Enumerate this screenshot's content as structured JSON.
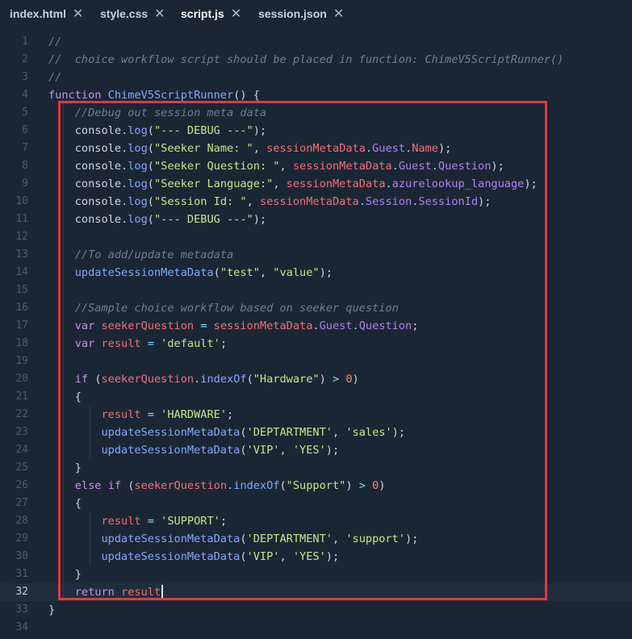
{
  "tabs": [
    {
      "label": "index.html",
      "active": false
    },
    {
      "label": "style.css",
      "active": false
    },
    {
      "label": "script.js",
      "active": true
    },
    {
      "label": "session.json",
      "active": false
    }
  ],
  "close_glyph": "✕",
  "current_line": 32,
  "code_lines": [
    {
      "n": "1",
      "tokens": [
        [
          "cm",
          "//"
        ]
      ]
    },
    {
      "n": "2",
      "tokens": [
        [
          "cm",
          "//  choice workflow script should be placed in function: ChimeV5ScriptRunner()"
        ]
      ]
    },
    {
      "n": "3",
      "tokens": [
        [
          "cm",
          "//"
        ]
      ]
    },
    {
      "n": "4",
      "tokens": [
        [
          "kw",
          "function "
        ],
        [
          "fn",
          "ChimeV5ScriptRunner"
        ],
        [
          "pn",
          "() {"
        ]
      ]
    },
    {
      "n": "5",
      "tokens": [
        [
          "pl",
          "    "
        ],
        [
          "cm",
          "//Debug out session meta data"
        ]
      ]
    },
    {
      "n": "6",
      "tokens": [
        [
          "pl",
          "    "
        ],
        [
          "pl",
          "console"
        ],
        [
          "op",
          "."
        ],
        [
          "fn",
          "log"
        ],
        [
          "pn",
          "("
        ],
        [
          "str",
          "\"--- DEBUG ---\""
        ],
        [
          "pn",
          ");"
        ]
      ]
    },
    {
      "n": "7",
      "tokens": [
        [
          "pl",
          "    "
        ],
        [
          "pl",
          "console"
        ],
        [
          "op",
          "."
        ],
        [
          "fn",
          "log"
        ],
        [
          "pn",
          "("
        ],
        [
          "str",
          "\"Seeker Name: \""
        ],
        [
          "pn",
          ", "
        ],
        [
          "var",
          "sessionMetaData"
        ],
        [
          "op",
          "."
        ],
        [
          "prop",
          "Guest"
        ],
        [
          "op",
          "."
        ],
        [
          "var",
          "Name"
        ],
        [
          "pn",
          ");"
        ]
      ]
    },
    {
      "n": "8",
      "tokens": [
        [
          "pl",
          "    "
        ],
        [
          "pl",
          "console"
        ],
        [
          "op",
          "."
        ],
        [
          "fn",
          "log"
        ],
        [
          "pn",
          "("
        ],
        [
          "str",
          "\"Seeker Question: \""
        ],
        [
          "pn",
          ", "
        ],
        [
          "var",
          "sessionMetaData"
        ],
        [
          "op",
          "."
        ],
        [
          "prop",
          "Guest"
        ],
        [
          "op",
          "."
        ],
        [
          "prop",
          "Question"
        ],
        [
          "pn",
          ");"
        ]
      ]
    },
    {
      "n": "9",
      "tokens": [
        [
          "pl",
          "    "
        ],
        [
          "pl",
          "console"
        ],
        [
          "op",
          "."
        ],
        [
          "fn",
          "log"
        ],
        [
          "pn",
          "("
        ],
        [
          "str",
          "\"Seeker Language:\""
        ],
        [
          "pn",
          ", "
        ],
        [
          "var",
          "sessionMetaData"
        ],
        [
          "op",
          "."
        ],
        [
          "prop",
          "azurelookup_language"
        ],
        [
          "pn",
          ");"
        ]
      ]
    },
    {
      "n": "10",
      "tokens": [
        [
          "pl",
          "    "
        ],
        [
          "pl",
          "console"
        ],
        [
          "op",
          "."
        ],
        [
          "fn",
          "log"
        ],
        [
          "pn",
          "("
        ],
        [
          "str",
          "\"Session Id: \""
        ],
        [
          "pn",
          ", "
        ],
        [
          "var",
          "sessionMetaData"
        ],
        [
          "op",
          "."
        ],
        [
          "prop",
          "Session"
        ],
        [
          "op",
          "."
        ],
        [
          "prop",
          "SessionId"
        ],
        [
          "pn",
          ");"
        ]
      ]
    },
    {
      "n": "11",
      "tokens": [
        [
          "pl",
          "    "
        ],
        [
          "pl",
          "console"
        ],
        [
          "op",
          "."
        ],
        [
          "fn",
          "log"
        ],
        [
          "pn",
          "("
        ],
        [
          "str",
          "\"--- DEBUG ---\""
        ],
        [
          "pn",
          ");"
        ]
      ]
    },
    {
      "n": "12",
      "tokens": []
    },
    {
      "n": "13",
      "tokens": [
        [
          "pl",
          "    "
        ],
        [
          "cm",
          "//To add/update metadata"
        ]
      ]
    },
    {
      "n": "14",
      "tokens": [
        [
          "pl",
          "    "
        ],
        [
          "fn",
          "updateSessionMetaData"
        ],
        [
          "pn",
          "("
        ],
        [
          "str",
          "\"test\""
        ],
        [
          "pn",
          ", "
        ],
        [
          "str",
          "\"value\""
        ],
        [
          "pn",
          ");"
        ]
      ]
    },
    {
      "n": "15",
      "tokens": []
    },
    {
      "n": "16",
      "tokens": [
        [
          "pl",
          "    "
        ],
        [
          "cm",
          "//Sample choice workflow based on seeker question"
        ]
      ]
    },
    {
      "n": "17",
      "tokens": [
        [
          "pl",
          "    "
        ],
        [
          "kw",
          "var "
        ],
        [
          "var",
          "seekerQuestion"
        ],
        [
          "op",
          " = "
        ],
        [
          "var",
          "sessionMetaData"
        ],
        [
          "op",
          "."
        ],
        [
          "prop",
          "Guest"
        ],
        [
          "op",
          "."
        ],
        [
          "prop",
          "Question"
        ],
        [
          "pn",
          ";"
        ]
      ]
    },
    {
      "n": "18",
      "tokens": [
        [
          "pl",
          "    "
        ],
        [
          "kw",
          "var "
        ],
        [
          "var",
          "result"
        ],
        [
          "op",
          " = "
        ],
        [
          "str",
          "'default'"
        ],
        [
          "pn",
          ";"
        ]
      ]
    },
    {
      "n": "19",
      "tokens": []
    },
    {
      "n": "20",
      "tokens": [
        [
          "pl",
          "    "
        ],
        [
          "kw",
          "if "
        ],
        [
          "pn",
          "("
        ],
        [
          "var",
          "seekerQuestion"
        ],
        [
          "op",
          "."
        ],
        [
          "fn",
          "indexOf"
        ],
        [
          "pn",
          "("
        ],
        [
          "str",
          "\"Hardware\""
        ],
        [
          "pn",
          ") "
        ],
        [
          "op",
          "> "
        ],
        [
          "num",
          "0"
        ],
        [
          "pn",
          ")"
        ]
      ]
    },
    {
      "n": "21",
      "tokens": [
        [
          "pl",
          "    "
        ],
        [
          "pn",
          "{"
        ]
      ]
    },
    {
      "n": "22",
      "tokens": [
        [
          "pl",
          "        "
        ],
        [
          "var",
          "result"
        ],
        [
          "op",
          " = "
        ],
        [
          "str",
          "'HARDWARE'"
        ],
        [
          "pn",
          ";"
        ]
      ]
    },
    {
      "n": "23",
      "tokens": [
        [
          "pl",
          "        "
        ],
        [
          "fn",
          "updateSessionMetaData"
        ],
        [
          "pn",
          "("
        ],
        [
          "str",
          "'DEPTARTMENT'"
        ],
        [
          "pn",
          ", "
        ],
        [
          "str",
          "'sales'"
        ],
        [
          "pn",
          ");"
        ]
      ]
    },
    {
      "n": "24",
      "tokens": [
        [
          "pl",
          "        "
        ],
        [
          "fn",
          "updateSessionMetaData"
        ],
        [
          "pn",
          "("
        ],
        [
          "str",
          "'VIP'"
        ],
        [
          "pn",
          ", "
        ],
        [
          "str",
          "'YES'"
        ],
        [
          "pn",
          ");"
        ]
      ]
    },
    {
      "n": "25",
      "tokens": [
        [
          "pl",
          "    "
        ],
        [
          "pn",
          "}"
        ]
      ]
    },
    {
      "n": "26",
      "tokens": [
        [
          "pl",
          "    "
        ],
        [
          "kw",
          "else if "
        ],
        [
          "pn",
          "("
        ],
        [
          "var",
          "seekerQuestion"
        ],
        [
          "op",
          "."
        ],
        [
          "fn",
          "indexOf"
        ],
        [
          "pn",
          "("
        ],
        [
          "str",
          "\"Support\""
        ],
        [
          "pn",
          ") "
        ],
        [
          "op",
          "> "
        ],
        [
          "num",
          "0"
        ],
        [
          "pn",
          ")"
        ]
      ]
    },
    {
      "n": "27",
      "tokens": [
        [
          "pl",
          "    "
        ],
        [
          "pn",
          "{"
        ]
      ]
    },
    {
      "n": "28",
      "tokens": [
        [
          "pl",
          "        "
        ],
        [
          "var",
          "result"
        ],
        [
          "op",
          " = "
        ],
        [
          "str",
          "'SUPPORT'"
        ],
        [
          "pn",
          ";"
        ]
      ]
    },
    {
      "n": "29",
      "tokens": [
        [
          "pl",
          "        "
        ],
        [
          "fn",
          "updateSessionMetaData"
        ],
        [
          "pn",
          "("
        ],
        [
          "str",
          "'DEPTARTMENT'"
        ],
        [
          "pn",
          ", "
        ],
        [
          "str",
          "'support'"
        ],
        [
          "pn",
          ");"
        ]
      ]
    },
    {
      "n": "30",
      "tokens": [
        [
          "pl",
          "        "
        ],
        [
          "fn",
          "updateSessionMetaData"
        ],
        [
          "pn",
          "("
        ],
        [
          "str",
          "'VIP'"
        ],
        [
          "pn",
          ", "
        ],
        [
          "str",
          "'YES'"
        ],
        [
          "pn",
          ");"
        ]
      ]
    },
    {
      "n": "31",
      "tokens": [
        [
          "pl",
          "    "
        ],
        [
          "pn",
          "}"
        ]
      ]
    },
    {
      "n": "32",
      "tokens": [
        [
          "pl",
          "    "
        ],
        [
          "kw",
          "return "
        ],
        [
          "var",
          "result"
        ]
      ]
    },
    {
      "n": "33",
      "tokens": [
        [
          "pn",
          "}"
        ]
      ]
    },
    {
      "n": "34",
      "tokens": []
    }
  ],
  "colors": {
    "background": "#1b2634",
    "highlight_box": "#e03a3a",
    "comment": "#6f7f93",
    "keyword": "#c792ea",
    "function": "#82aaff",
    "string": "#c3e88d",
    "variable": "#f07178",
    "property": "#b083f0",
    "number": "#f78c6c"
  }
}
